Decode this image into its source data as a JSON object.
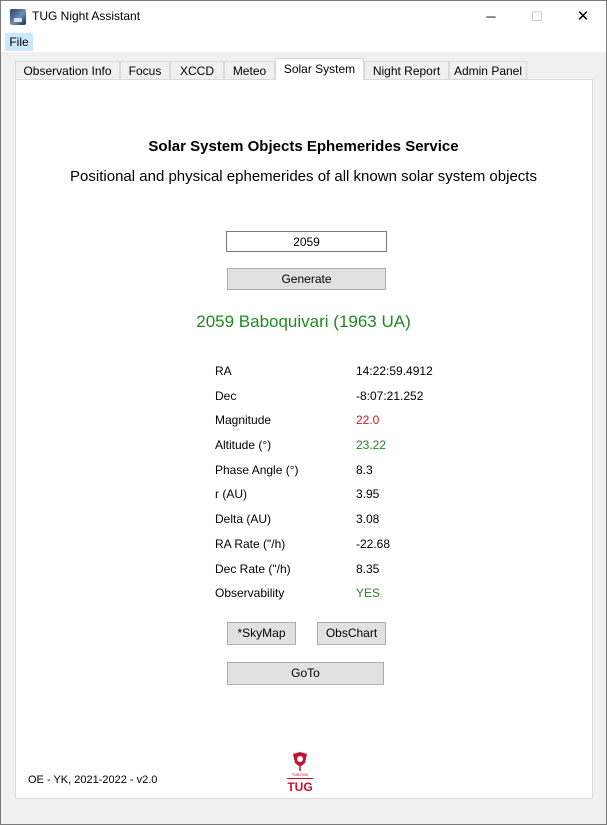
{
  "window": {
    "title": "TUG Night Assistant",
    "minimize_glyph": "─",
    "maximize_glyph": "☐",
    "close_glyph": "✕"
  },
  "menu": {
    "file": "File"
  },
  "tabs": [
    {
      "label": "Observation Info"
    },
    {
      "label": "Focus"
    },
    {
      "label": "XCCD"
    },
    {
      "label": "Meteo"
    },
    {
      "label": "Solar System",
      "active": true
    },
    {
      "label": "Night Report"
    },
    {
      "label": "Admin Panel"
    }
  ],
  "service": {
    "title": "Solar System Objects Ephemerides Service",
    "subtitle": "Positional and physical ephemerides of all known solar system objects"
  },
  "query": {
    "value": "2059"
  },
  "buttons": {
    "generate": "Generate",
    "skymap": "*SkyMap",
    "obschart": "ObsChart",
    "goto": "GoTo"
  },
  "object_name": "2059 Baboquivari (1963 UA)",
  "ephemeris": [
    {
      "label": "RA",
      "value": "14:22:59.4912"
    },
    {
      "label": "Dec",
      "value": "-8:07:21.252"
    },
    {
      "label": "Magnitude",
      "value": "22.0"
    },
    {
      "label": "Altitude (°)",
      "value": "23.22"
    },
    {
      "label": "Phase Angle (°)",
      "value": "8.3"
    },
    {
      "label": "r (AU)",
      "value": "3.95"
    },
    {
      "label": "Delta (AU)",
      "value": "3.08"
    },
    {
      "label": "RA Rate (\"/h)",
      "value": "-22.68"
    },
    {
      "label": "Dec Rate (\"/h)",
      "value": "8.35"
    },
    {
      "label": "Observability",
      "value": "YES"
    }
  ],
  "colors": {
    "magnitude": "#d11a1a",
    "altitude": "#1e8a1e",
    "observability": "#1e8a1e",
    "object_name": "#1e8a1e",
    "logo_red": "#c8102e"
  },
  "footer": {
    "credits": "OE - YK, 2021-2022 - v2.0"
  },
  "logo": {
    "top_text": "TÜBİTAK",
    "bottom_text": "TUG",
    "icon": "tubitak-tug-logo-icon"
  }
}
